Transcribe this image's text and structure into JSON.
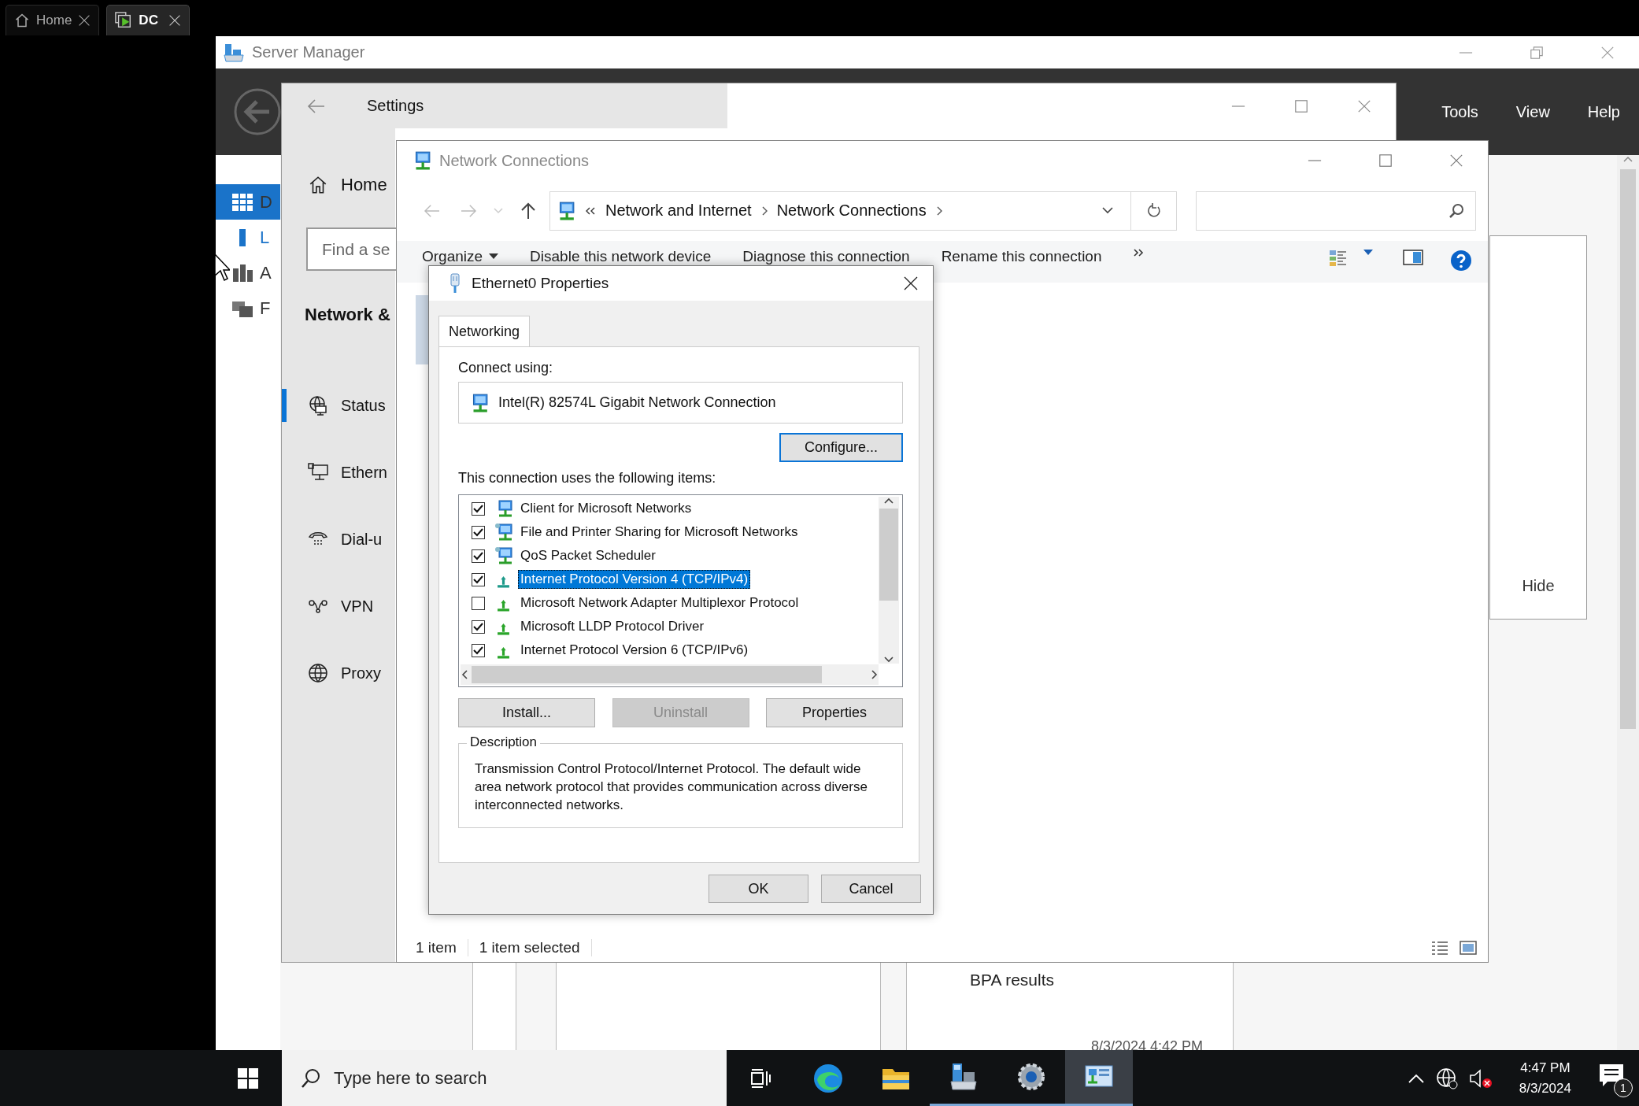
{
  "browser_tabs": [
    {
      "kind": "home",
      "label": "Home",
      "selected": false
    },
    {
      "kind": "vm",
      "label": "DC",
      "selected": true
    }
  ],
  "server_manager": {
    "title": "Server Manager",
    "menu": [
      "Tools",
      "View",
      "Help"
    ],
    "nav": [
      {
        "kind": "dashboard",
        "label": "D",
        "selected": true
      },
      {
        "kind": "local",
        "label": "L",
        "selected": false
      },
      {
        "kind": "all",
        "label": "A",
        "selected": false
      },
      {
        "kind": "files",
        "label": "F",
        "selected": false
      }
    ],
    "hide": "Hide",
    "tile": {
      "title": "BPA results",
      "timestamp": "8/3/2024 4:42 PM"
    }
  },
  "settings": {
    "title": "Settings",
    "home": "Home",
    "search_placeholder": "Find a se",
    "section": "Network &",
    "nav": [
      {
        "kind": "status",
        "label": "Status",
        "selected": true
      },
      {
        "kind": "ethernet",
        "label": "Ethern",
        "selected": false
      },
      {
        "kind": "dialup",
        "label": "Dial-u",
        "selected": false
      },
      {
        "kind": "vpn",
        "label": "VPN",
        "selected": false
      },
      {
        "kind": "proxy",
        "label": "Proxy",
        "selected": false
      }
    ]
  },
  "network_connections": {
    "title": "Network Connections",
    "breadcrumb": [
      "Network and Internet",
      "Network Connections"
    ],
    "commands": [
      "Organize",
      "Disable this network device",
      "Diagnose this connection",
      "Rename this connection"
    ],
    "status": [
      "1 item",
      "1 item selected"
    ]
  },
  "dialog": {
    "title": "Ethernet0 Properties",
    "tabs": [
      {
        "label": "Networking",
        "selected": true
      }
    ],
    "connect_label": "Connect using:",
    "adapter": "Intel(R) 82574L Gigabit Network Connection",
    "configure": {
      "label": "Configure...",
      "focused": true
    },
    "items_label": "This connection uses the following items:",
    "items": [
      {
        "kind": "client",
        "label": "Client for Microsoft Networks",
        "checked": true,
        "selected": false
      },
      {
        "kind": "service",
        "label": "File and Printer Sharing for Microsoft Networks",
        "checked": true,
        "selected": false
      },
      {
        "kind": "service",
        "label": "QoS Packet Scheduler",
        "checked": true,
        "selected": false
      },
      {
        "kind": "protocol",
        "label": "Internet Protocol Version 4 (TCP/IPv4)",
        "checked": true,
        "selected": true
      },
      {
        "kind": "protocol",
        "label": "Microsoft Network Adapter Multiplexor Protocol",
        "checked": false,
        "selected": false
      },
      {
        "kind": "protocol",
        "label": "Microsoft LLDP Protocol Driver",
        "checked": true,
        "selected": false
      },
      {
        "kind": "protocol",
        "label": "Internet Protocol Version 6 (TCP/IPv6)",
        "checked": true,
        "selected": false
      }
    ],
    "buttons": [
      {
        "label": "Install...",
        "disabled": false
      },
      {
        "label": "Uninstall",
        "disabled": true
      },
      {
        "label": "Properties",
        "disabled": false
      }
    ],
    "description_label": "Description",
    "description": "Transmission Control Protocol/Internet Protocol. The default wide area network protocol that provides communication across diverse interconnected networks.",
    "actions": [
      "OK",
      "Cancel"
    ]
  },
  "taskbar": {
    "search_placeholder": "Type here to search",
    "apps": [
      {
        "kind": "task-view",
        "running": false,
        "active": false
      },
      {
        "kind": "edge",
        "running": false,
        "active": false
      },
      {
        "kind": "explorer",
        "running": false,
        "active": false
      },
      {
        "kind": "server-manager",
        "running": true,
        "active": false
      },
      {
        "kind": "settings",
        "running": true,
        "active": false
      },
      {
        "kind": "network-connections",
        "running": true,
        "active": true
      }
    ],
    "clock": {
      "time": "4:47 PM",
      "date": "8/3/2024"
    },
    "notification_count": "1"
  }
}
